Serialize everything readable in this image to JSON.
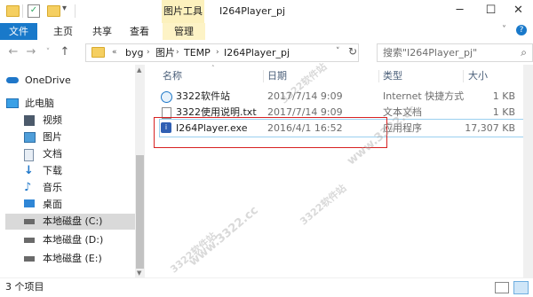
{
  "window": {
    "title": "I264Player_pj",
    "context_tab": "图片工具",
    "minimize": "─",
    "maximize": "☐",
    "close": "✕"
  },
  "ribbon": {
    "tabs": [
      "文件",
      "主页",
      "共享",
      "查看",
      "管理"
    ],
    "help": "?"
  },
  "address": {
    "prefix": "«",
    "crumbs": [
      "byg",
      "图片",
      "TEMP",
      "I264Player_pj"
    ]
  },
  "search": {
    "placeholder": "搜索\"I264Player_pj\""
  },
  "nav": {
    "items": [
      {
        "label": "OneDrive",
        "icon": "cloud-icon"
      },
      {
        "label": "此电脑",
        "icon": "computer-icon"
      },
      {
        "label": "视频",
        "icon": "video-icon"
      },
      {
        "label": "图片",
        "icon": "picture-icon"
      },
      {
        "label": "文档",
        "icon": "document-icon"
      },
      {
        "label": "下载",
        "icon": "download-icon"
      },
      {
        "label": "音乐",
        "icon": "music-icon"
      },
      {
        "label": "桌面",
        "icon": "desktop-icon"
      },
      {
        "label": "本地磁盘 (C:)",
        "icon": "drive-icon"
      },
      {
        "label": "本地磁盘 (D:)",
        "icon": "drive-icon"
      },
      {
        "label": "本地磁盘 (E:)",
        "icon": "drive-icon"
      }
    ]
  },
  "columns": {
    "name": "名称",
    "date": "日期",
    "type": "类型",
    "size": "大小"
  },
  "files": [
    {
      "name": "3322软件站",
      "date": "2017/7/14 9:09",
      "type": "Internet 快捷方式",
      "size": "1 KB",
      "icon": "internet-shortcut-icon"
    },
    {
      "name": "3322使用说明.txt",
      "date": "2017/7/14 9:09",
      "type": "文本文档",
      "size": "1 KB",
      "icon": "text-file-icon"
    },
    {
      "name": "I264Player.exe",
      "date": "2016/4/1 16:52",
      "type": "应用程序",
      "size": "17,307 KB",
      "icon": "app-exe-icon"
    }
  ],
  "status": {
    "count": "3 个项目"
  },
  "watermark": [
    "3322软件站",
    "www.3322.cc",
    "3322软件站",
    "3322软件站",
    "www.3322.cc"
  ],
  "colors": {
    "accent": "#1979ca",
    "context_tab": "#fcf1bd",
    "highlight_box": "#d82222",
    "selection": "#9ad0ef"
  }
}
